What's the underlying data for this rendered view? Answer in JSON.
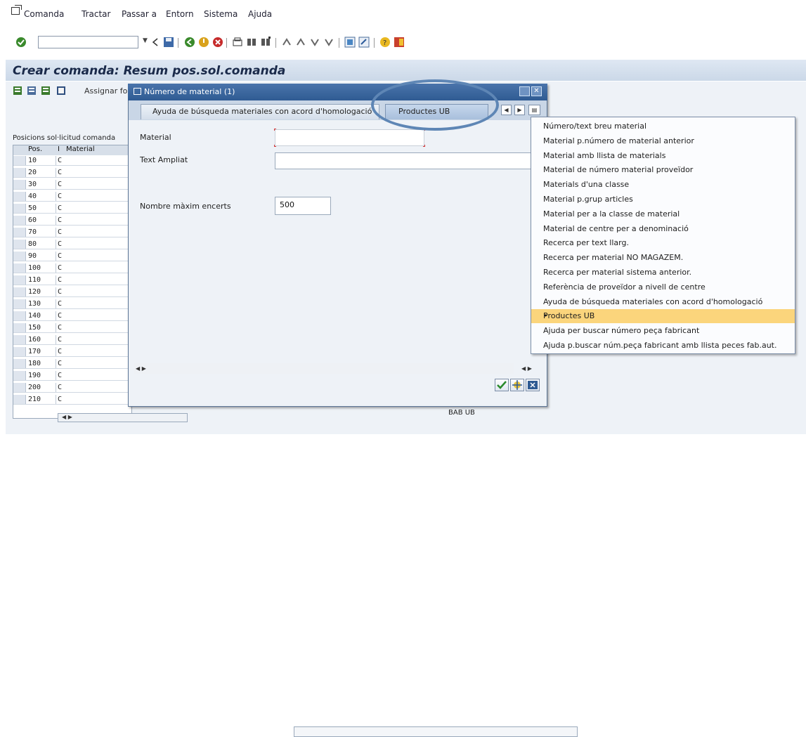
{
  "menubar": {
    "items": [
      "Comanda",
      "Tractar",
      "Passar a",
      "Entorn",
      "Sistema",
      "Ajuda"
    ]
  },
  "toolbar": {
    "command_field": {
      "value": "",
      "placeholder": ""
    },
    "icons": [
      "enter-icon",
      "back-icon",
      "save-icon",
      "back-green-icon",
      "exit-icon",
      "cancel-icon",
      "print-icon",
      "find-icon",
      "find-next-icon",
      "first-page-icon",
      "prev-page-icon",
      "next-page-icon",
      "last-page-icon",
      "new-session-icon",
      "shortcut-icon",
      "help-icon",
      "layout-icon"
    ]
  },
  "page": {
    "title": "Crear comanda: Resum pos.sol.comanda",
    "app_toolbar_label": "Assignar for"
  },
  "items_table": {
    "title": "Posicions sol·licitud comanda",
    "columns": [
      "Pos.",
      "I",
      "Material"
    ],
    "rows": [
      {
        "pos": "10",
        "i": "C"
      },
      {
        "pos": "20",
        "i": "C"
      },
      {
        "pos": "30",
        "i": "C"
      },
      {
        "pos": "40",
        "i": "C"
      },
      {
        "pos": "50",
        "i": "C"
      },
      {
        "pos": "60",
        "i": "C"
      },
      {
        "pos": "70",
        "i": "C"
      },
      {
        "pos": "80",
        "i": "C"
      },
      {
        "pos": "90",
        "i": "C"
      },
      {
        "pos": "100",
        "i": "C"
      },
      {
        "pos": "110",
        "i": "C"
      },
      {
        "pos": "120",
        "i": "C"
      },
      {
        "pos": "130",
        "i": "C"
      },
      {
        "pos": "140",
        "i": "C"
      },
      {
        "pos": "150",
        "i": "C"
      },
      {
        "pos": "160",
        "i": "C"
      },
      {
        "pos": "170",
        "i": "C"
      },
      {
        "pos": "180",
        "i": "C"
      },
      {
        "pos": "190",
        "i": "C"
      },
      {
        "pos": "200",
        "i": "C"
      },
      {
        "pos": "210",
        "i": "C"
      }
    ],
    "bottom_text": "BAB UB"
  },
  "dialog": {
    "title": "Número de material (1)",
    "tabs": [
      {
        "label": "Ayuda de búsqueda materiales con acord d'homologació",
        "active": false
      },
      {
        "label": "Productes UB",
        "active": true
      }
    ],
    "fields": {
      "material_label": "Material",
      "material_value": "",
      "text_label": "Text Ampliat",
      "text_value": "",
      "max_hits_label": "Nombre màxim encerts",
      "max_hits_value": "500"
    }
  },
  "dropdown": {
    "items": [
      {
        "label": "Número/text breu material",
        "selected": false
      },
      {
        "label": "Material p.número de material anterior",
        "selected": false
      },
      {
        "label": "Material amb llista de materials",
        "selected": false
      },
      {
        "label": "Material de número material proveïdor",
        "selected": false
      },
      {
        "label": "Materials d'una classe",
        "selected": false
      },
      {
        "label": "Material p.grup articles",
        "selected": false
      },
      {
        "label": "Material per a la classe de material",
        "selected": false
      },
      {
        "label": "Material de centre per a denominació",
        "selected": false
      },
      {
        "label": "Recerca per text llarg.",
        "selected": false
      },
      {
        "label": "Recerca per material NO MAGAZEM.",
        "selected": false
      },
      {
        "label": "Recerca per material sistema anterior.",
        "selected": false
      },
      {
        "label": "Referència de proveïdor a nivell de centre",
        "selected": false
      },
      {
        "label": "Ayuda de búsqueda materiales con acord d'homologació",
        "selected": false
      },
      {
        "label": "Productes UB",
        "selected": true
      },
      {
        "label": "Ajuda per buscar número peça fabricant",
        "selected": false
      },
      {
        "label": "Ajuda p.buscar núm.peça fabricant amb llista peces fab.aut.",
        "selected": false
      }
    ],
    "bullet": "•"
  },
  "colors": {
    "dialog_title_bg": "#2f5b93",
    "highlight": "#fbd57c",
    "annotation_circle": "#5e86b5"
  }
}
